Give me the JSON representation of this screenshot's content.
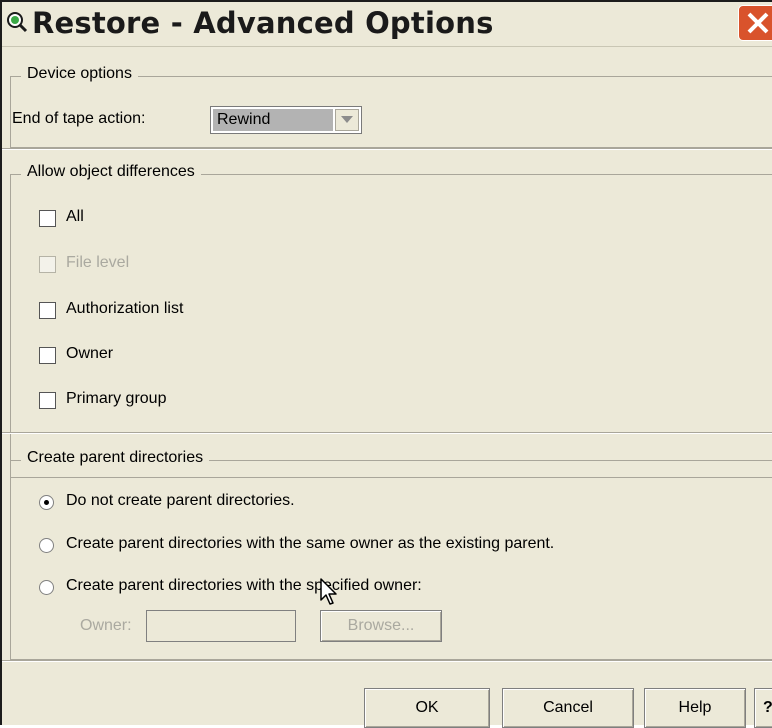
{
  "window": {
    "title": "Restore - Advanced Options"
  },
  "device_options": {
    "title": "Device options",
    "end_of_tape_label": "End of tape action:",
    "end_of_tape_value": "Rewind"
  },
  "allow_object_differences": {
    "title": "Allow object differences",
    "items": [
      {
        "label": "All",
        "checked": false,
        "enabled": true
      },
      {
        "label": "File level",
        "checked": false,
        "enabled": false
      },
      {
        "label": "Authorization list",
        "checked": false,
        "enabled": true
      },
      {
        "label": "Owner",
        "checked": false,
        "enabled": true
      },
      {
        "label": "Primary group",
        "checked": false,
        "enabled": true
      }
    ]
  },
  "create_parent_directories": {
    "title": "Create parent directories",
    "options": [
      {
        "label": "Do not create parent directories.",
        "selected": true
      },
      {
        "label": "Create parent directories with the same owner as the existing parent.",
        "selected": false
      },
      {
        "label": "Create parent directories with the specified owner:",
        "selected": false
      }
    ],
    "owner_label": "Owner:",
    "owner_value": "",
    "browse_label": "Browse..."
  },
  "buttons": {
    "ok": "OK",
    "cancel": "Cancel",
    "help": "Help",
    "question": "?"
  },
  "colors": {
    "dialog_bg": "#ece9d8",
    "close_button": "#d9532c",
    "disabled_text": "#aaa9a0"
  },
  "icons": {
    "title": "restore-icon",
    "close": "close-icon",
    "dropdown": "chevron-down-icon",
    "cursor": "mouse-pointer-icon"
  }
}
